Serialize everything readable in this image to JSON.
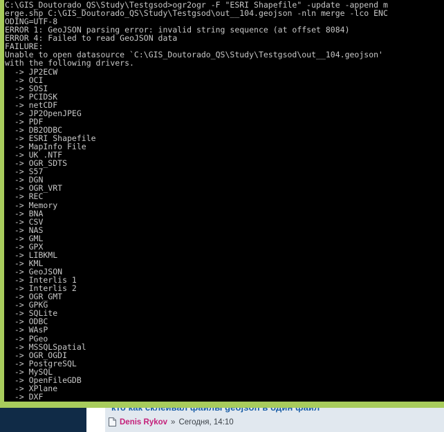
{
  "window": {
    "chrome_color": "#a8cc5c",
    "screen_bg": "#000000",
    "text_color": "#c8c8c8"
  },
  "console": {
    "lines": [
      "C:\\GIS_Doutorado_QS\\Study\\Testgsod>ogr2ogr -F \"ESRI Shapefile\" -update -append m",
      "erge.shp C:\\GIS_Doutorado_QS\\Study\\Testgsod\\out__104.geojson -nln merge -lco ENC",
      "ODING=UTF-8",
      "ERROR 1: GeoJSON parsing error: invalid string sequence (at offset 8084)",
      "ERROR 4: Failed to read GeoJSON data",
      "FAILURE:",
      "Unable to open datasource `C:\\GIS_Doutorado_QS\\Study\\Testgsod\\out__104.geojson'",
      "with the following drivers.",
      "  -> JP2ECW",
      "  -> OCI",
      "  -> SOSI",
      "  -> PCIDSK",
      "  -> netCDF",
      "  -> JP2OpenJPEG",
      "  -> PDF",
      "  -> DB2ODBC",
      "  -> ESRI Shapefile",
      "  -> MapInfo File",
      "  -> UK .NTF",
      "  -> OGR_SDTS",
      "  -> S57",
      "  -> DGN",
      "  -> OGR_VRT",
      "  -> REC",
      "  -> Memory",
      "  -> BNA",
      "  -> CSV",
      "  -> NAS",
      "  -> GML",
      "  -> GPX",
      "  -> LIBKML",
      "  -> KML",
      "  -> GeoJSON",
      "  -> Interlis 1",
      "  -> Interlis 2",
      "  -> OGR_GMT",
      "  -> GPKG",
      "  -> SQLite",
      "  -> ODBC",
      "  -> WAsP",
      "  -> PGeo",
      "  -> MSSQLSpatial",
      "  -> OGR_OGDI",
      "  -> PostgreSQL",
      "  -> MySQL",
      "  -> OpenFileGDB",
      "  -> XPlane",
      "  -> DXF"
    ],
    "command": {
      "prompt": "C:\\GIS_Doutorado_QS\\Study\\Testgsod>",
      "program": "ogr2ogr",
      "format_flag": "-F",
      "format_value": "\"ESRI Shapefile\"",
      "update_flag": "-update",
      "append_flag": "-append",
      "output": "merge.shp",
      "input": "C:\\GIS_Doutorado_QS\\Study\\Testgsod\\out__104.geojson",
      "nln_flag": "-nln",
      "nln_value": "merge",
      "lco_flag": "-lco",
      "lco_value": "ENCODING=UTF-8"
    },
    "errors": [
      "ERROR 1: GeoJSON parsing error: invalid string sequence (at offset 8084)",
      "ERROR 4: Failed to read GeoJSON data"
    ],
    "failure_label": "FAILURE:",
    "failure_detail": "Unable to open datasource `C:\\GIS_Doutorado_QS\\Study\\Testgsod\\out__104.geojson' with the following drivers.",
    "drivers": [
      "JP2ECW",
      "OCI",
      "SOSI",
      "PCIDSK",
      "netCDF",
      "JP2OpenJPEG",
      "PDF",
      "DB2ODBC",
      "ESRI Shapefile",
      "MapInfo File",
      "UK .NTF",
      "OGR_SDTS",
      "S57",
      "DGN",
      "OGR_VRT",
      "REC",
      "Memory",
      "BNA",
      "CSV",
      "NAS",
      "GML",
      "GPX",
      "LIBKML",
      "KML",
      "GeoJSON",
      "Interlis 1",
      "Interlis 2",
      "OGR_GMT",
      "GPKG",
      "SQLite",
      "ODBC",
      "WAsP",
      "PGeo",
      "MSSQLSpatial",
      "OGR_OGDI",
      "PostgreSQL",
      "MySQL",
      "OpenFileGDB",
      "XPlane",
      "DXF"
    ]
  },
  "background_page": {
    "topic_title": "кто как склеивал файлы geojson в один файл",
    "post": {
      "icon": "document-icon",
      "author": "Denis Rykov",
      "separator": "»",
      "time": "Сегодня, 14:10"
    },
    "colors": {
      "author": "#c4207a",
      "title": "#1c5fa8",
      "panel": "#e1e8ef",
      "sidebar": "#102b47"
    }
  }
}
